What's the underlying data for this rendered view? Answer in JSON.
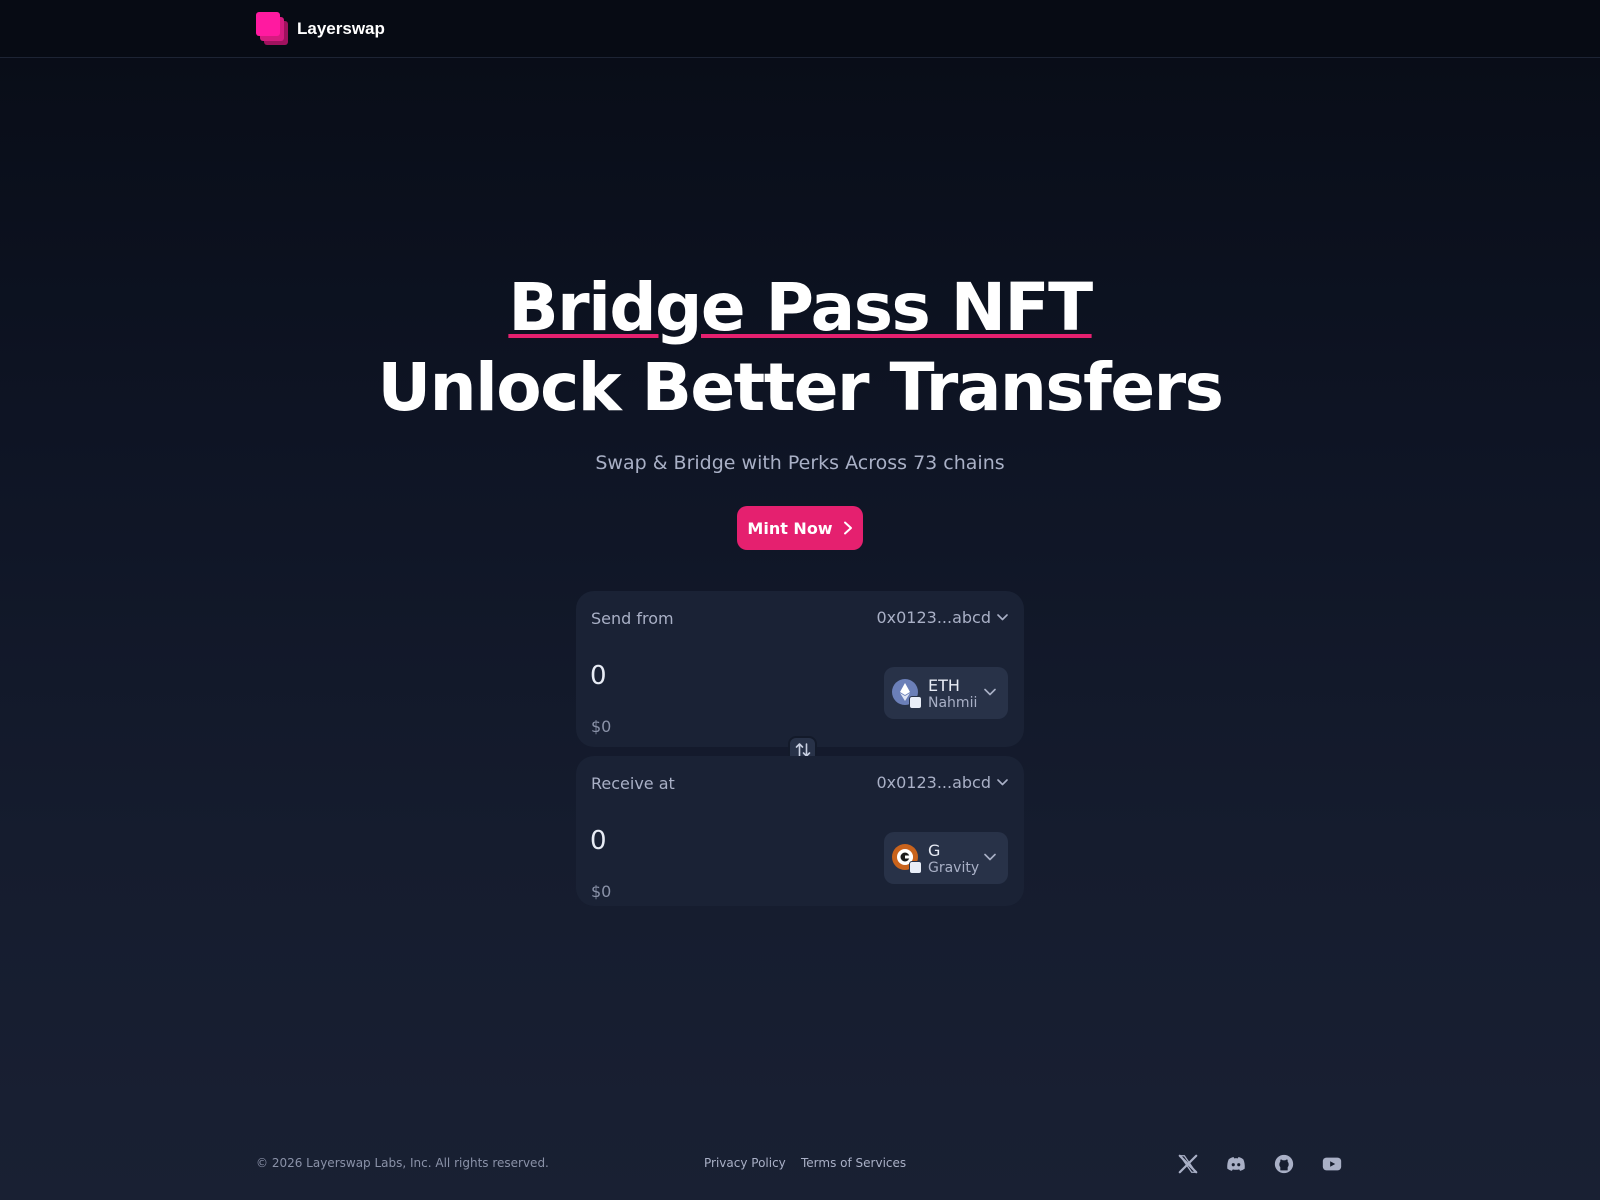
{
  "header": {
    "brand": "Layerswap",
    "brand_color": "#ff1aa0"
  },
  "hero": {
    "title_line1": "Bridge Pass NFT",
    "title_line2": "Unlock Better Transfers",
    "subtitle": "Swap & Bridge with Perks Across 73 chains",
    "cta_label": "Mint Now",
    "accent_color": "#e5206f"
  },
  "swap": {
    "from": {
      "label": "Send from",
      "address": "0x0123...abcd",
      "amount": "0",
      "usd": "$0",
      "token": "ETH",
      "network": "Nahmii",
      "token_icon": "ethereum-icon"
    },
    "to": {
      "label": "Receive at",
      "address": "0x0123...abcd",
      "amount": "0",
      "usd": "$0",
      "token": "G",
      "network": "Gravity",
      "token_icon": "gravity-icon"
    },
    "swap_icon": "arrows-up-down-icon"
  },
  "footer": {
    "copyright": "© 2026 Layerswap Labs, Inc. All rights reserved.",
    "privacy": "Privacy Policy",
    "terms": "Terms of Services",
    "social_icons": [
      "x-icon",
      "discord-icon",
      "github-icon",
      "youtube-icon"
    ]
  }
}
